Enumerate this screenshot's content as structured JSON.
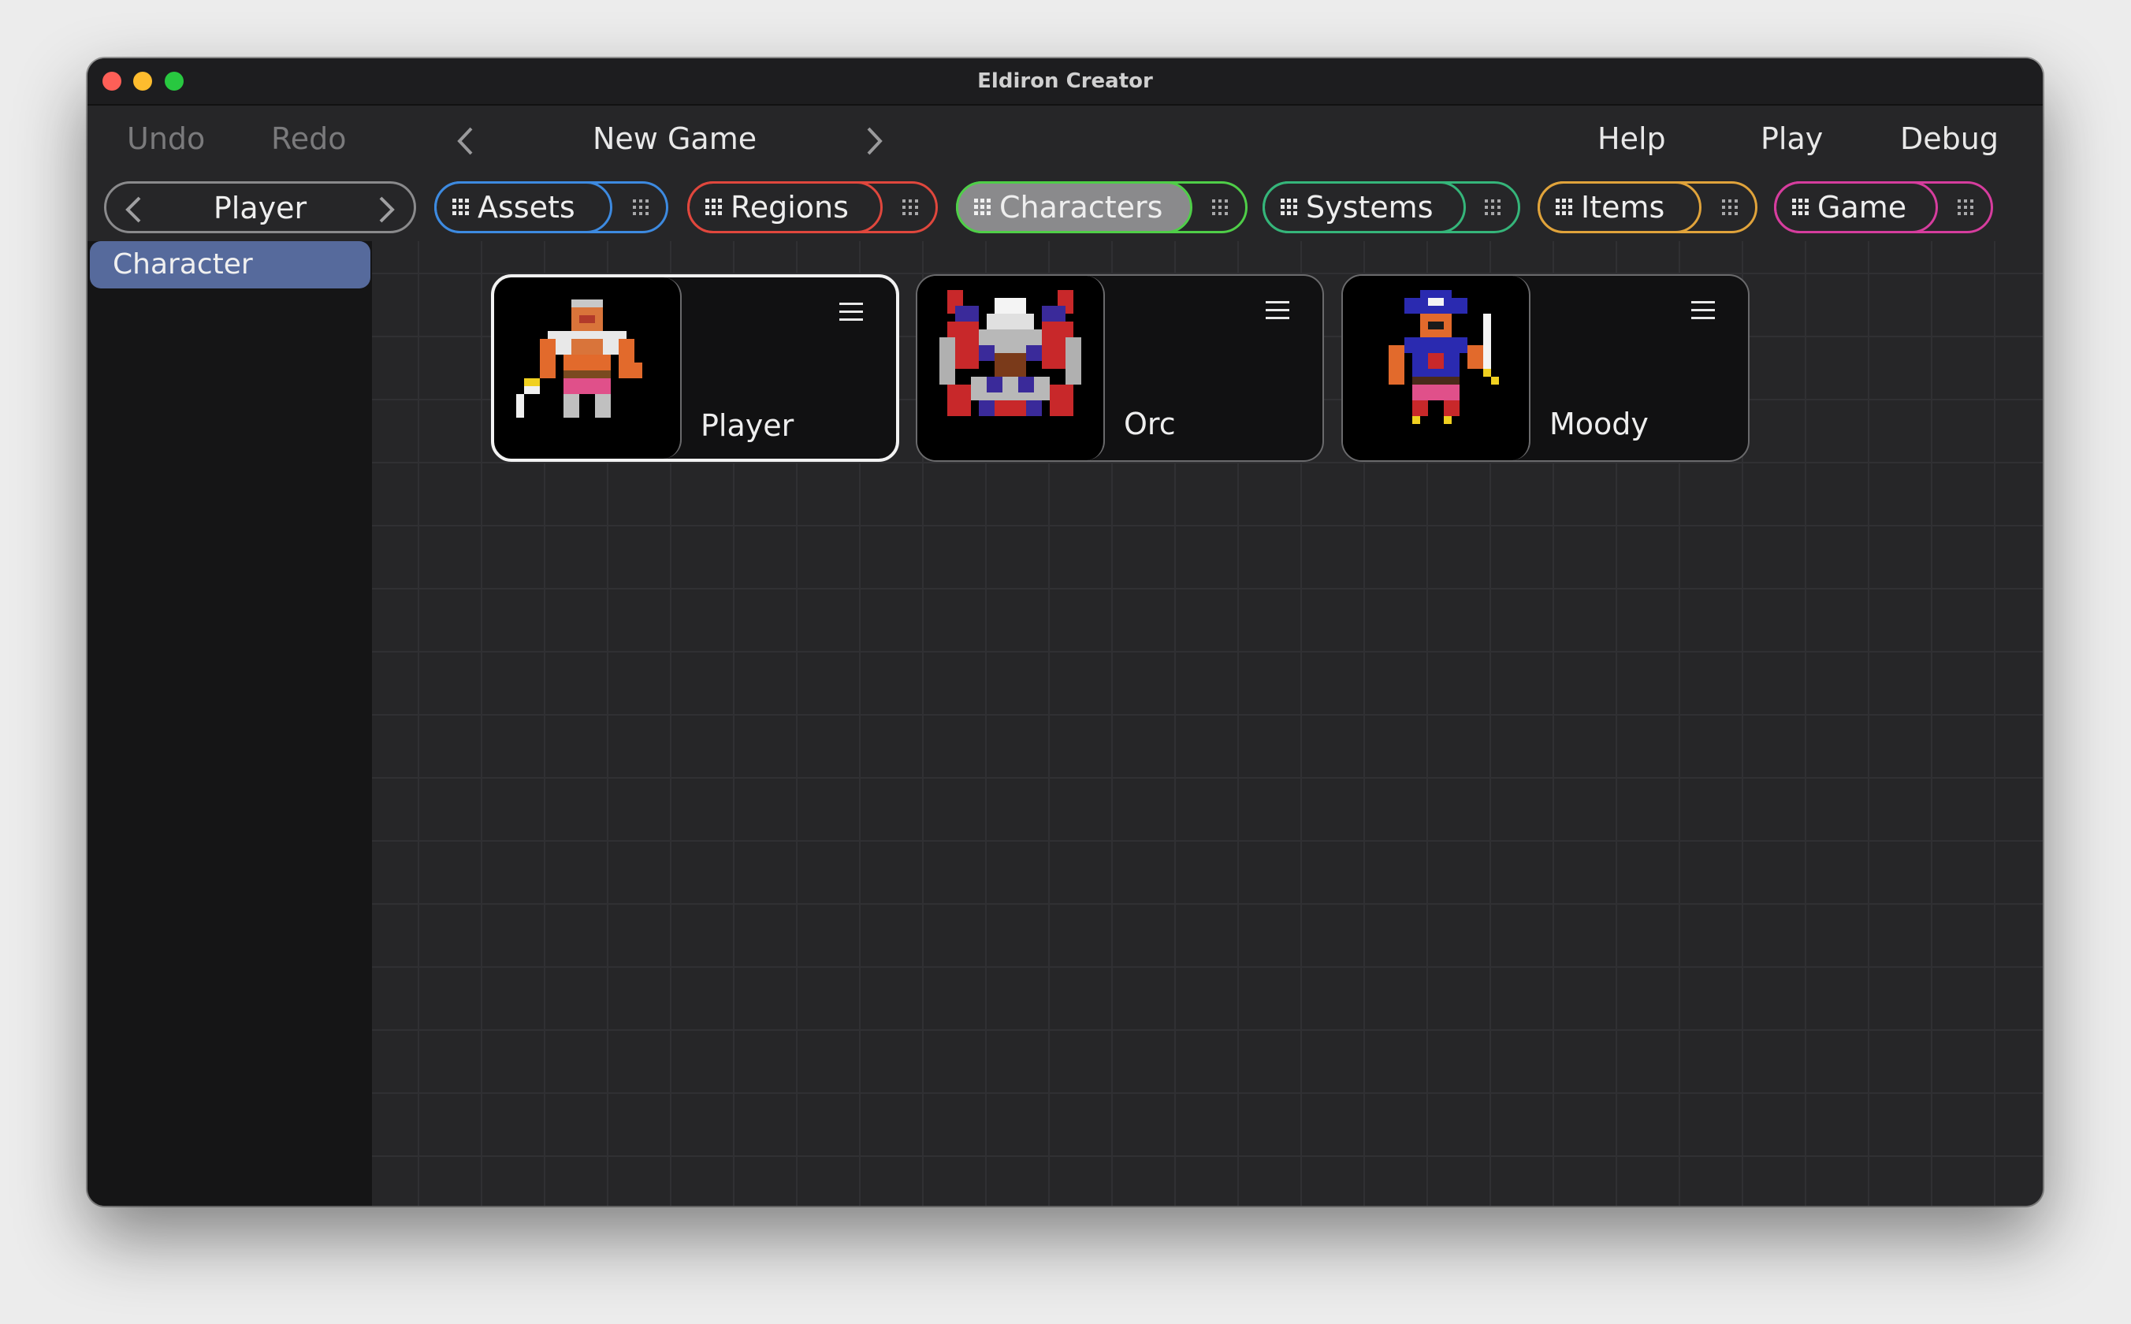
{
  "window": {
    "title": "Eldiron Creator"
  },
  "toolbar": {
    "undo_label": "Undo",
    "redo_label": "Redo",
    "project_name": "New Game",
    "help_label": "Help",
    "play_label": "Play",
    "debug_label": "Debug"
  },
  "character_nav": {
    "current": "Player"
  },
  "tabs": [
    {
      "label": "Assets",
      "color": "#3d8ae0",
      "active": false
    },
    {
      "label": "Regions",
      "color": "#e0473d",
      "active": false
    },
    {
      "label": "Characters",
      "color": "#4fce48",
      "active": true
    },
    {
      "label": "Systems",
      "color": "#35b57a",
      "active": false
    },
    {
      "label": "Items",
      "color": "#e0a33b",
      "active": false
    },
    {
      "label": "Game",
      "color": "#d63d9e",
      "active": false
    }
  ],
  "sidebar": {
    "items": [
      {
        "label": "Character",
        "selected": true
      }
    ]
  },
  "characters": [
    {
      "name": "Player",
      "selected": true,
      "icon": "warrior-sprite"
    },
    {
      "name": "Orc",
      "selected": false,
      "icon": "orc-sprite"
    },
    {
      "name": "Moody",
      "selected": false,
      "icon": "pirate-sprite"
    }
  ],
  "colors": {
    "accent_selected": "#566a9c",
    "background": "#262628"
  }
}
